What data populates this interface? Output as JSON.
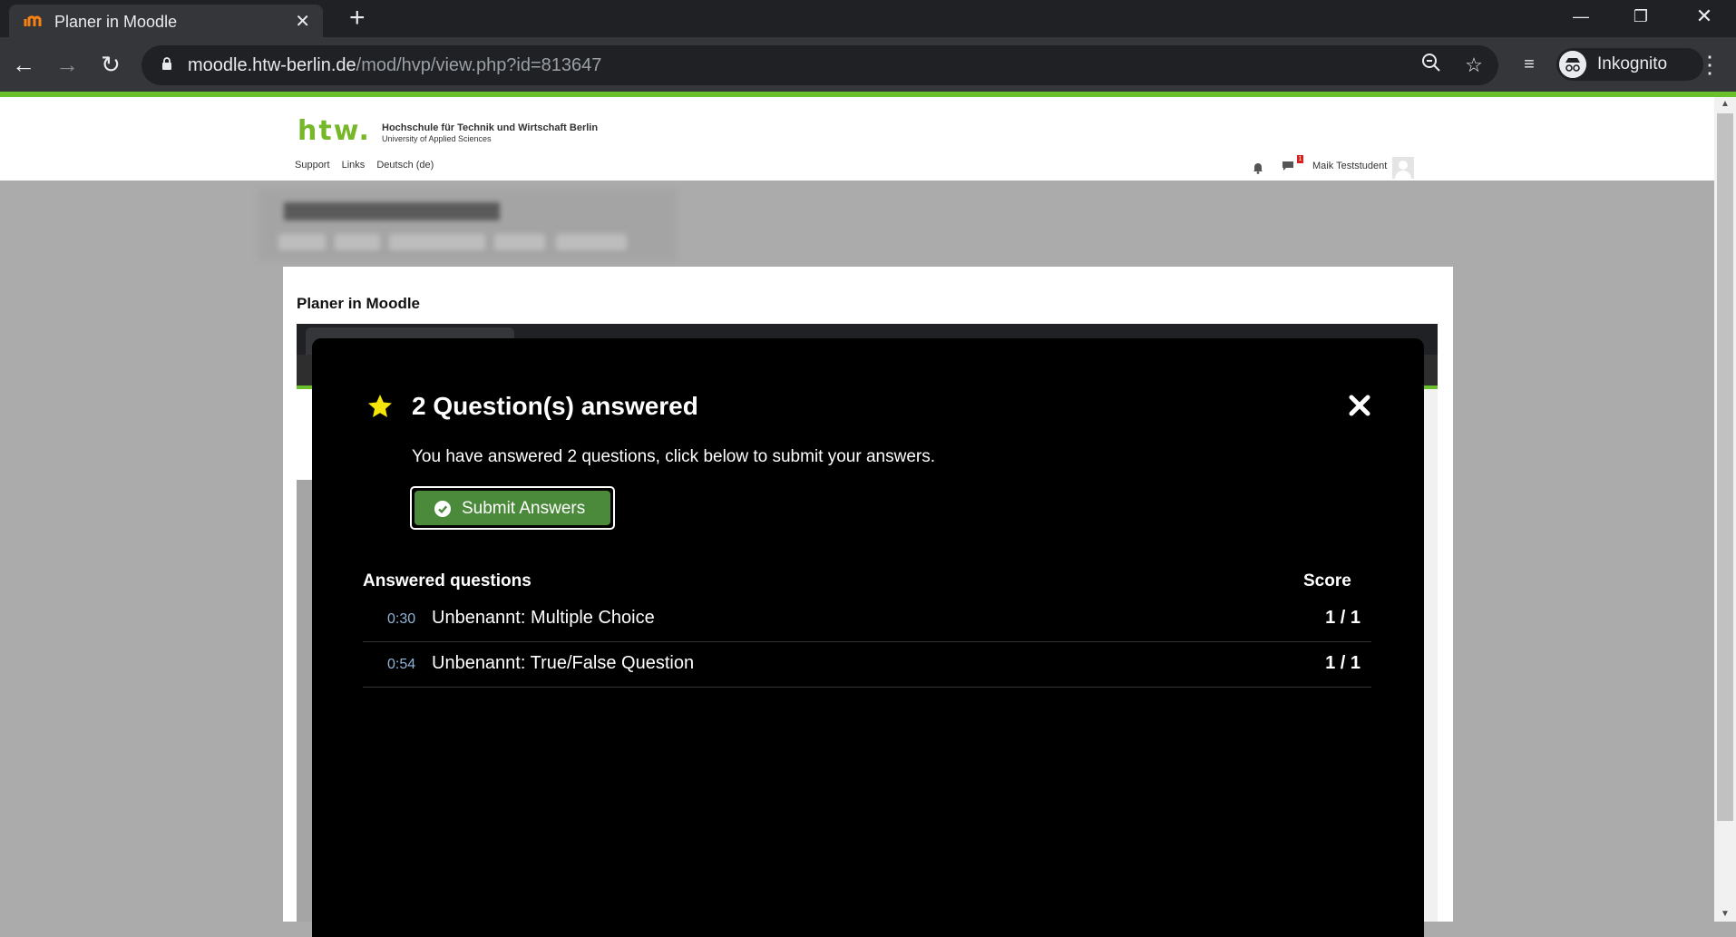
{
  "browser": {
    "tab_title": "Planer in Moodle",
    "url_host": "moodle.htw-berlin.de",
    "url_path": "/mod/hvp/view.php?id=813647",
    "profile_label": "Inkognito",
    "icons": [
      "back-icon",
      "forward-icon",
      "reload-icon",
      "lock-icon",
      "zoom-icon",
      "star-icon",
      "reading-list-icon",
      "incognito-icon",
      "menu-icon"
    ]
  },
  "site": {
    "logo_mark": "htw.",
    "logo_line1": "Hochschule für Technik und Wirtschaft Berlin",
    "logo_line2": "University of Applied Sciences",
    "nav": [
      "Support",
      "Links",
      "Deutsch (de)"
    ],
    "message_badge": "1",
    "username": "Maik Teststudent",
    "brand_color": "#76b82a"
  },
  "content": {
    "title": "Planer in Moodle"
  },
  "modal": {
    "title": "2 Question(s) answered",
    "description": "You have answered 2 questions, click below to submit your answers.",
    "submit_label": "Submit Answers",
    "answered_header": "Answered questions",
    "score_header": "Score",
    "rows": [
      {
        "time": "0:30",
        "name": "Unbenannt: Multiple Choice",
        "score": "1 / 1"
      },
      {
        "time": "0:54",
        "name": "Unbenannt: True/False Question",
        "score": "1 / 1"
      }
    ],
    "accent_color": "#4a8a3a",
    "star_color": "#f5e50a"
  }
}
